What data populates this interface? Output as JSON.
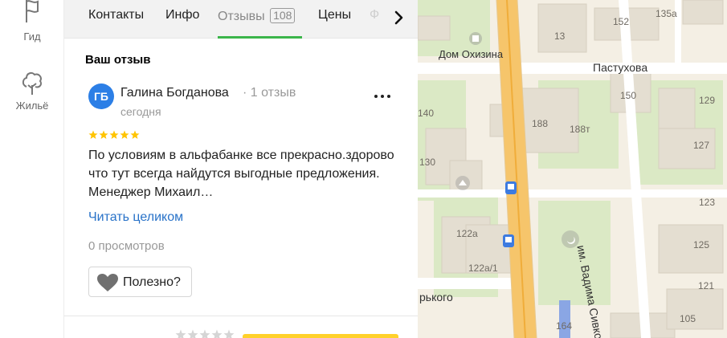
{
  "rail": {
    "guide_label": "Гид",
    "housing_label": "Жильё"
  },
  "tabs": {
    "contacts": "Контакты",
    "info": "Инфо",
    "reviews": "Отзывы",
    "reviews_count": "108",
    "prices": "Цены",
    "more": "Ф"
  },
  "review": {
    "section_title": "Ваш отзыв",
    "avatar_initials": "ГБ",
    "author": "Галина Богданова",
    "author_reviews": "· 1 отзыв",
    "date": "сегодня",
    "rating": 5,
    "text": "По условиям в альфабанке все прекрасно.здорово что тут всегда найдутся выгодные предложения. Менеджер Михаил…",
    "read_more": "Читать целиком",
    "views": "0 просмотров",
    "helpful": "Полезно?"
  },
  "map": {
    "poi_name": "Дом Охизина",
    "streets": {
      "pastukhova": "Пастухова",
      "sivkova": "им. Вадима Сивкова",
      "gorkogo": "рького"
    },
    "house_numbers": [
      "135а",
      "152",
      "13",
      "150",
      "129",
      "188",
      "188т",
      "140",
      "127",
      "130",
      "123",
      "122а",
      "125",
      "122а/1",
      "164",
      "105",
      "121"
    ]
  },
  "colors": {
    "accent_green": "#3bb54a",
    "link_blue": "#2872c8",
    "avatar_blue": "#2c7fe6",
    "star_yellow": "#ffc400",
    "road_orange": "#f6c56b"
  }
}
